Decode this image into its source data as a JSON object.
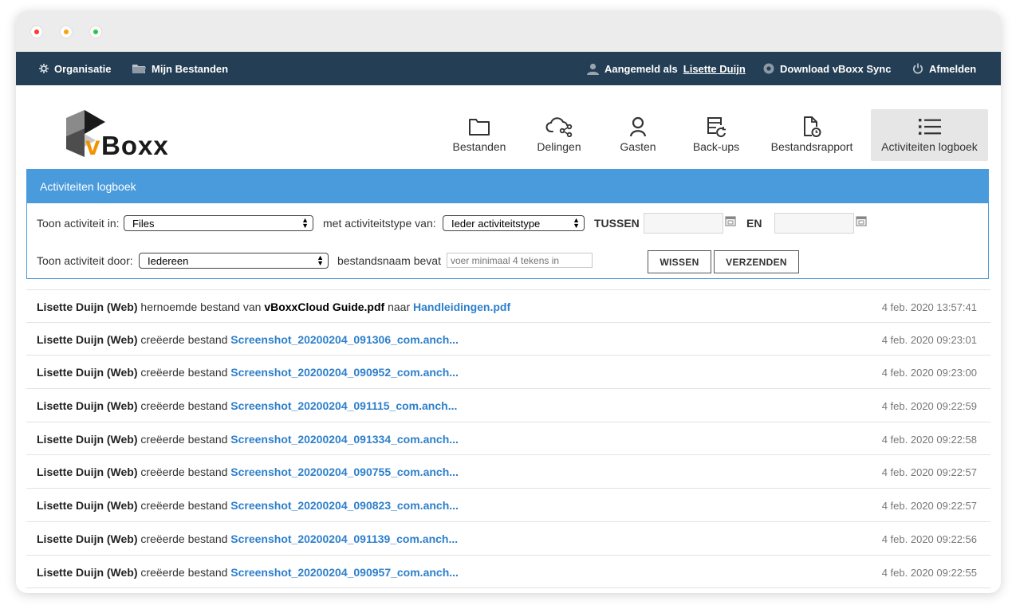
{
  "window": {
    "controls": [
      "close",
      "minimize",
      "maximize"
    ]
  },
  "topnav": {
    "organisatie": "Organisatie",
    "mijn_bestanden": "Mijn Bestanden",
    "logged_in_prefix": "Aangemeld als",
    "logged_in_user": "Lisette Duijn",
    "download": "Download vBoxx Sync",
    "logout": "Afmelden"
  },
  "brand": {
    "logo_v": "v",
    "logo_rest": "Boxx",
    "accent_color": "#f39200"
  },
  "tabs": [
    {
      "label": "Bestanden",
      "icon": "folder-icon",
      "active": false
    },
    {
      "label": "Delingen",
      "icon": "cloud-share-icon",
      "active": false
    },
    {
      "label": "Gasten",
      "icon": "user-icon",
      "active": false
    },
    {
      "label": "Back-ups",
      "icon": "backup-icon",
      "active": false
    },
    {
      "label": "Bestandsrapport",
      "icon": "file-report-icon",
      "active": true
    },
    {
      "label": "Activiteiten logboek",
      "icon": "list-icon",
      "active": true
    }
  ],
  "panel": {
    "title": "Activiteiten logboek",
    "show_in_label": "Toon activiteit in:",
    "show_in_value": "Files",
    "type_label": "met activiteitstype van:",
    "type_value": "Ieder activiteitstype",
    "between_label": "TUSSEN",
    "and_label": "EN",
    "date_from": "",
    "date_to": "",
    "by_label": "Toon activiteit door:",
    "by_value": "Iedereen",
    "filename_label": "bestandsnaam bevat",
    "filename_placeholder": "voer minimaal 4 tekens in",
    "clear_button": "WISSEN",
    "submit_button": "VERZENDEN"
  },
  "activities": [
    {
      "user": "Lisette Duijn (Web)",
      "action": "hernoemde bestand van",
      "file": "vBoxxCloud Guide.pdf",
      "connector": "naar",
      "target": "Handleidingen.pdf",
      "timestamp": "4 feb. 2020 13:57:41"
    },
    {
      "user": "Lisette Duijn (Web)",
      "action": "creëerde bestand",
      "file": "",
      "connector": "",
      "target": "Screenshot_20200204_091306_com.anch...",
      "timestamp": "4 feb. 2020 09:23:01"
    },
    {
      "user": "Lisette Duijn (Web)",
      "action": "creëerde bestand",
      "file": "",
      "connector": "",
      "target": "Screenshot_20200204_090952_com.anch...",
      "timestamp": "4 feb. 2020 09:23:00"
    },
    {
      "user": "Lisette Duijn (Web)",
      "action": "creëerde bestand",
      "file": "",
      "connector": "",
      "target": "Screenshot_20200204_091115_com.anch...",
      "timestamp": "4 feb. 2020 09:22:59"
    },
    {
      "user": "Lisette Duijn (Web)",
      "action": "creëerde bestand",
      "file": "",
      "connector": "",
      "target": "Screenshot_20200204_091334_com.anch...",
      "timestamp": "4 feb. 2020 09:22:58"
    },
    {
      "user": "Lisette Duijn (Web)",
      "action": "creëerde bestand",
      "file": "",
      "connector": "",
      "target": "Screenshot_20200204_090755_com.anch...",
      "timestamp": "4 feb. 2020 09:22:57"
    },
    {
      "user": "Lisette Duijn (Web)",
      "action": "creëerde bestand",
      "file": "",
      "connector": "",
      "target": "Screenshot_20200204_090823_com.anch...",
      "timestamp": "4 feb. 2020 09:22:57"
    },
    {
      "user": "Lisette Duijn (Web)",
      "action": "creëerde bestand",
      "file": "",
      "connector": "",
      "target": "Screenshot_20200204_091139_com.anch...",
      "timestamp": "4 feb. 2020 09:22:56"
    },
    {
      "user": "Lisette Duijn (Web)",
      "action": "creëerde bestand",
      "file": "",
      "connector": "",
      "target": "Screenshot_20200204_090957_com.anch...",
      "timestamp": "4 feb. 2020 09:22:55"
    }
  ]
}
